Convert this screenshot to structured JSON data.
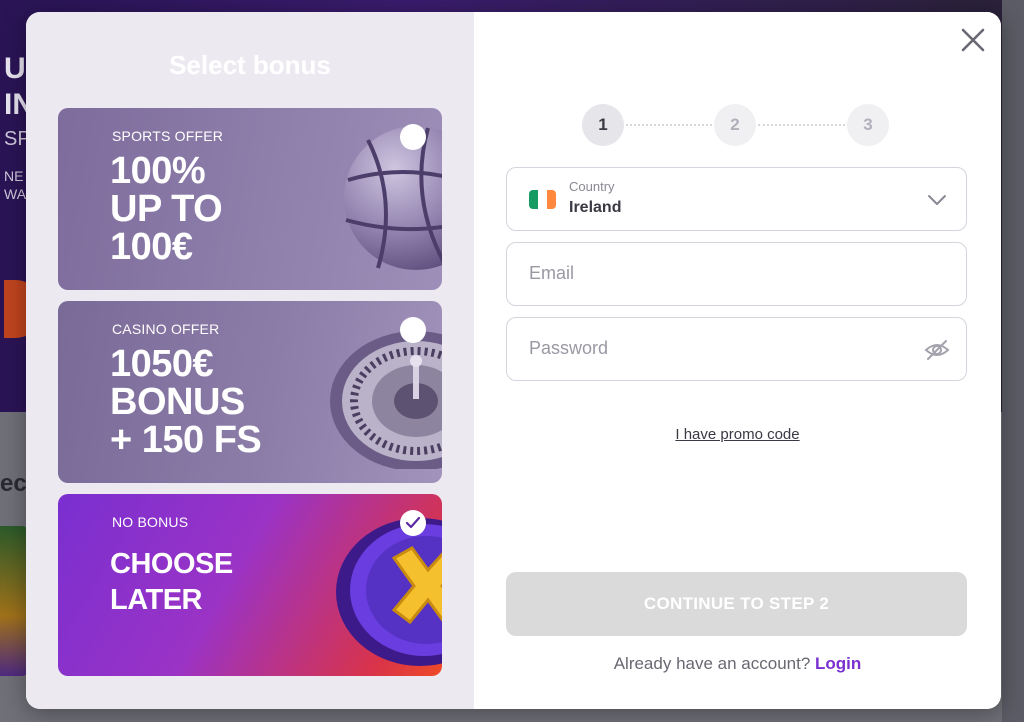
{
  "background": {
    "hero_line1": "U",
    "hero_line2": "IN",
    "hero_line3": "SP",
    "hero_line4": "NE",
    "hero_line5": "WA",
    "section_label": "ec"
  },
  "bonus_panel": {
    "title": "Select bonus",
    "cards": [
      {
        "kicker": "SPORTS OFFER",
        "headline_1": "100%",
        "headline_2": "UP TO",
        "headline_3": "100€",
        "selected": false
      },
      {
        "kicker": "CASINO OFFER",
        "headline_1": "1050€",
        "headline_2": "BONUS",
        "headline_3": "+ 150 FS",
        "selected": false
      },
      {
        "kicker": "NO BONUS",
        "headline_1": "CHOOSE",
        "headline_2": "LATER",
        "selected": true
      }
    ]
  },
  "steps": [
    "1",
    "2",
    "3"
  ],
  "active_step": 1,
  "form": {
    "country_label": "Country",
    "country_value": "Ireland",
    "email_placeholder": "Email",
    "password_placeholder": "Password",
    "promo_link": "I have promo code",
    "continue_label": "CONTINUE TO STEP 2",
    "login_prompt": "Already have an account?",
    "login_link": "Login"
  },
  "colors": {
    "accent": "#7a2fd0",
    "flag_green": "#169b62",
    "flag_white": "#ffffff",
    "flag_orange": "#ff883e"
  }
}
